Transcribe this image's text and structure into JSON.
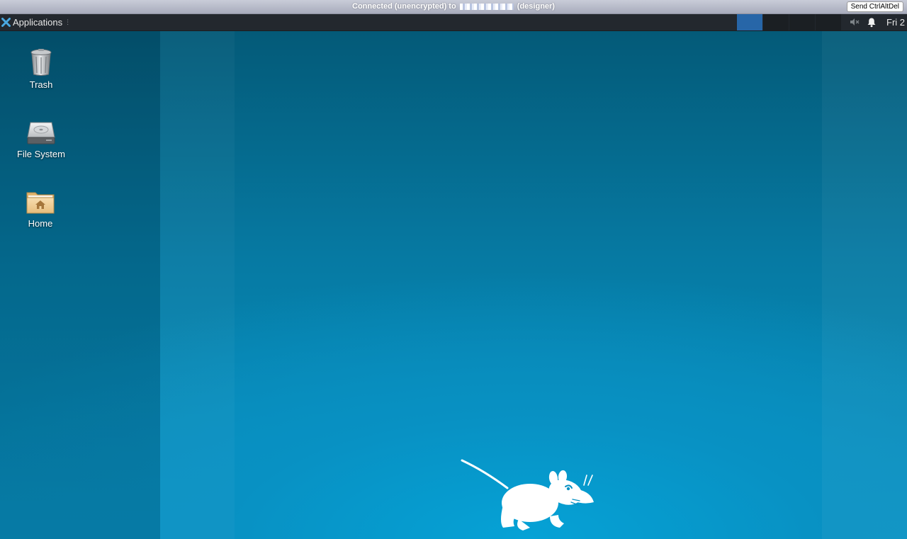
{
  "vnc": {
    "status_prefix": "Connected (unencrypted) to",
    "status_suffix": "(designer)",
    "send_button": "Send CtrlAltDel"
  },
  "panel": {
    "applications_label": "Applications",
    "handle_glyph": "⋮",
    "workspaces": [
      {
        "active": true
      },
      {
        "active": false
      },
      {
        "active": false
      },
      {
        "active": false
      }
    ],
    "clock": "Fri 2",
    "tray_icons": [
      "volume-muted-icon",
      "notification-bell-icon"
    ],
    "colors": {
      "panel_bg": "#23282e",
      "active_workspace": "#2766a8"
    }
  },
  "desktop": {
    "icons": [
      {
        "name": "trash-icon",
        "label": "Trash"
      },
      {
        "name": "file-system-icon",
        "label": "File System"
      },
      {
        "name": "home-folder-icon",
        "label": "Home"
      }
    ],
    "wallpaper": {
      "logo": "xfce-mouse-icon",
      "colors": [
        "#045a78",
        "#0894c5"
      ]
    }
  }
}
